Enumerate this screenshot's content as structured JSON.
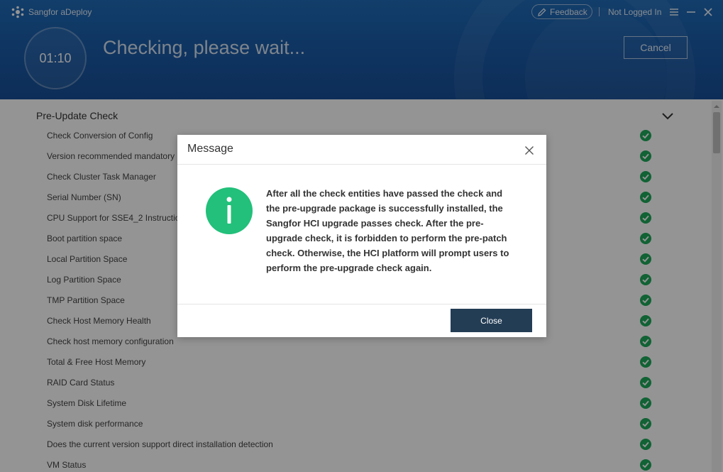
{
  "app": {
    "title": "Sangfor aDeploy",
    "feedback_label": "Feedback",
    "login_status": "Not Logged In"
  },
  "header": {
    "timer": "01:10",
    "status_title": "Checking, please wait...",
    "cancel_label": "Cancel"
  },
  "section": {
    "title": "Pre-Update Check",
    "items": [
      {
        "label": "Check Conversion of Config",
        "status": "passed"
      },
      {
        "label": "Version recommended mandatory",
        "status": "passed"
      },
      {
        "label": "Check Cluster Task Manager",
        "status": "passed"
      },
      {
        "label": "Serial Number (SN)",
        "status": "passed"
      },
      {
        "label": "CPU Support for SSE4_2 Instructio",
        "status": "passed"
      },
      {
        "label": "Boot partition space",
        "status": "passed"
      },
      {
        "label": "Local Partition Space",
        "status": "passed"
      },
      {
        "label": "Log Partition Space",
        "status": "passed"
      },
      {
        "label": "TMP Partition Space",
        "status": "passed"
      },
      {
        "label": "Check Host Memory Health",
        "status": "passed"
      },
      {
        "label": "Check host memory configuration",
        "status": "passed"
      },
      {
        "label": "Total & Free Host Memory",
        "status": "passed"
      },
      {
        "label": "RAID Card Status",
        "status": "passed"
      },
      {
        "label": "System Disk Lifetime",
        "status": "passed"
      },
      {
        "label": "System disk performance",
        "status": "passed"
      },
      {
        "label": "Does the current version support direct installation detection",
        "status": "passed"
      },
      {
        "label": "VM Status",
        "status": "passed"
      }
    ]
  },
  "modal": {
    "title": "Message",
    "message": "After all the check entities have passed the check and the pre-upgrade package is successfully installed, the Sangfor HCI upgrade passes check. After the pre-upgrade check, it is forbidden to perform the pre-patch check. Otherwise, the HCI platform will prompt users to perform the pre-upgrade check again.",
    "close_label": "Close",
    "icon": "info-icon"
  },
  "colors": {
    "header_blue": "#1a5aa6",
    "success_green": "#1eaa5a",
    "info_green": "#22c07a",
    "close_button": "#233d55"
  }
}
